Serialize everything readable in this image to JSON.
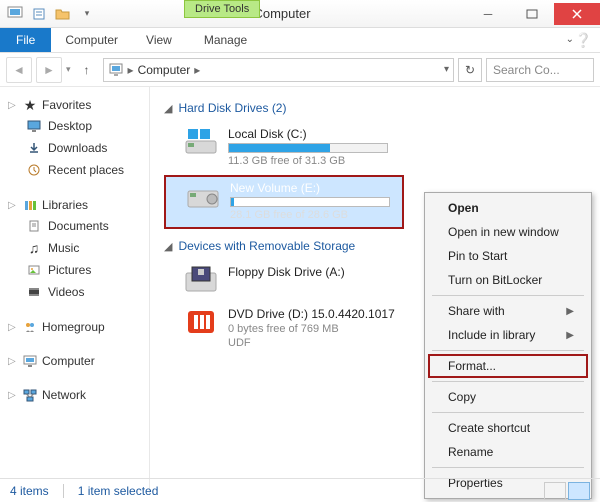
{
  "window": {
    "title": "Computer",
    "drive_tools": "Drive Tools"
  },
  "tabs": {
    "file": "File",
    "computer": "Computer",
    "view": "View",
    "manage": "Manage"
  },
  "address": {
    "path": "Computer",
    "sep": "▸"
  },
  "search": {
    "placeholder": "Search Co..."
  },
  "sidebar": {
    "favorites": {
      "label": "Favorites",
      "items": [
        "Desktop",
        "Downloads",
        "Recent places"
      ]
    },
    "libraries": {
      "label": "Libraries",
      "items": [
        "Documents",
        "Music",
        "Pictures",
        "Videos"
      ]
    },
    "homegroup": "Homegroup",
    "computer": "Computer",
    "network": "Network"
  },
  "sections": {
    "hdd": "Hard Disk Drives (2)",
    "removable": "Devices with Removable Storage"
  },
  "drives": {
    "c": {
      "name": "Local Disk (C:)",
      "free": "11.3 GB free of 31.3 GB",
      "fill_pct": 64
    },
    "e": {
      "name": "New Volume (E:)",
      "free": "28.1 GB free of 28.6 GB",
      "fill_pct": 2
    },
    "floppy": {
      "name": "Floppy Disk Drive (A:)"
    },
    "dvd": {
      "name": "DVD Drive (D:) 15.0.4420.1017",
      "free": "0 bytes free of 769 MB",
      "fs": "UDF"
    }
  },
  "context_menu": {
    "open": "Open",
    "open_new": "Open in new window",
    "pin": "Pin to Start",
    "bitlocker": "Turn on BitLocker",
    "share": "Share with",
    "include": "Include in library",
    "format": "Format...",
    "copy": "Copy",
    "shortcut": "Create shortcut",
    "rename": "Rename",
    "properties": "Properties"
  },
  "status": {
    "items": "4 items",
    "selected": "1 item selected"
  }
}
